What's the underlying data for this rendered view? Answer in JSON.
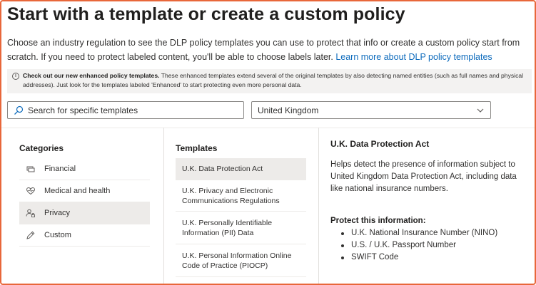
{
  "header": {
    "title": "Start with a template or create a custom policy",
    "description": "Choose an industry regulation to see the DLP policy templates you can use to protect that info or create a custom policy start from scratch. If you need to protect labeled content, you'll be able to choose labels later.",
    "learn_more_link": "Learn more about DLP policy templates"
  },
  "banner": {
    "icon": "info-icon",
    "bold_text": "Check out our new enhanced policy templates.",
    "text": " These enhanced templates extend several of the original templates by also detecting named entities (such as full names and physical addresses). Just look for the templates labeled 'Enhanced' to start protecting even more personal data."
  },
  "search": {
    "placeholder": "Search for specific templates",
    "icon": "search-icon"
  },
  "region_dropdown": {
    "selected": "United Kingdom",
    "icon": "chevron-down-icon"
  },
  "categories": {
    "heading": "Categories",
    "items": [
      {
        "label": "Financial",
        "icon": "financial-icon",
        "selected": false
      },
      {
        "label": "Medical and health",
        "icon": "medical-heart-icon",
        "selected": false
      },
      {
        "label": "Privacy",
        "icon": "privacy-person-icon",
        "selected": true
      },
      {
        "label": "Custom",
        "icon": "custom-pencil-icon",
        "selected": false
      }
    ]
  },
  "templates": {
    "heading": "Templates",
    "items": [
      {
        "label": "U.K. Data Protection Act",
        "selected": true
      },
      {
        "label": "U.K. Privacy and Electronic Communications Regulations",
        "selected": false
      },
      {
        "label": "U.K. Personally Identifiable Information (PII) Data",
        "selected": false
      },
      {
        "label": "U.K. Personal Information Online Code of Practice (PIOCP)",
        "selected": false
      }
    ]
  },
  "detail": {
    "title": "U.K. Data Protection Act",
    "description": "Helps detect the presence of information subject to United Kingdom Data Protection Act, including data like national insurance numbers.",
    "protect_heading": "Protect this information:",
    "protect_items": [
      "U.K. National Insurance Number (NINO)",
      "U.S. / U.K. Passport Number",
      "SWIFT Code"
    ]
  },
  "colors": {
    "frame_border": "#e8673a",
    "link": "#0f6cbd",
    "selected_bg": "#edebe9",
    "banner_bg": "#f3f2f1"
  }
}
